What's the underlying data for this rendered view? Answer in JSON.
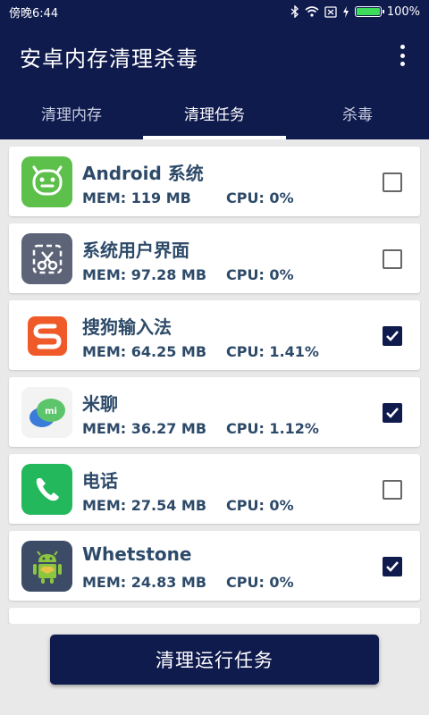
{
  "status_bar": {
    "time": "傍晚6:44",
    "battery_text": "100%",
    "battery_level": 1.0
  },
  "app_bar": {
    "title": "安卓内存清理杀毒"
  },
  "tabs": [
    {
      "label": "清理内存",
      "active": false
    },
    {
      "label": "清理任务",
      "active": true
    },
    {
      "label": "杀毒",
      "active": false
    }
  ],
  "tasks": [
    {
      "name": "Android 系统",
      "mem": "MEM: 119 MB",
      "cpu": "CPU: 0%",
      "checked": false,
      "icon": "android-system-icon"
    },
    {
      "name": "系统用户界面",
      "mem": "MEM: 97.28 MB",
      "cpu": "CPU: 0%",
      "checked": false,
      "icon": "system-ui-icon"
    },
    {
      "name": "搜狗输入法",
      "mem": "MEM: 64.25 MB",
      "cpu": "CPU: 1.41%",
      "checked": true,
      "icon": "sogou-input-icon"
    },
    {
      "name": "米聊",
      "mem": "MEM: 36.27 MB",
      "cpu": "CPU: 1.12%",
      "checked": true,
      "icon": "mitalk-icon"
    },
    {
      "name": "电话",
      "mem": "MEM: 27.54 MB",
      "cpu": "CPU: 0%",
      "checked": false,
      "icon": "phone-icon"
    },
    {
      "name": "Whetstone",
      "mem": "MEM: 24.83 MB",
      "cpu": "CPU: 0%",
      "checked": true,
      "icon": "whetstone-icon"
    }
  ],
  "footer": {
    "clean_button_label": "清理运行任务"
  },
  "colors": {
    "primary": "#0f1a4d",
    "text": "#2d4a69",
    "background": "#e9e9e9"
  }
}
